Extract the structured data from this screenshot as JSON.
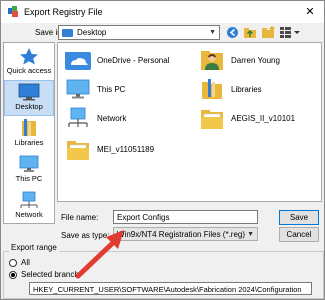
{
  "window": {
    "title": "Export Registry File"
  },
  "save_in": {
    "label": "Save in:",
    "value": "Desktop"
  },
  "places": [
    {
      "label": "Quick access",
      "icon": "quick-access-icon"
    },
    {
      "label": "Desktop",
      "icon": "desktop-icon",
      "selected": true
    },
    {
      "label": "Libraries",
      "icon": "libraries-icon"
    },
    {
      "label": "This PC",
      "icon": "this-pc-icon"
    },
    {
      "label": "Network",
      "icon": "network-icon"
    }
  ],
  "files": [
    {
      "name": "OneDrive - Personal",
      "icon": "onedrive-icon"
    },
    {
      "name": "Darren Young",
      "icon": "user-folder-icon"
    },
    {
      "name": "This PC",
      "icon": "this-pc-icon"
    },
    {
      "name": "Libraries",
      "icon": "libraries-icon"
    },
    {
      "name": "Network",
      "icon": "network-icon"
    },
    {
      "name": "AEGIS_II_v10101",
      "icon": "folder-icon"
    },
    {
      "name": "MEI_v11051189",
      "icon": "folder-icon"
    }
  ],
  "file_name": {
    "label": "File name:",
    "value": "Export Configs"
  },
  "save_as_type": {
    "label": "Save as type:",
    "value": "Win9x/NT4 Registration Files (*.reg)"
  },
  "buttons": {
    "save": "Save",
    "cancel": "Cancel"
  },
  "export_range": {
    "title": "Export range",
    "all_label": "All",
    "selected_label": "Selected branch",
    "selected": "selected_branch",
    "branch_value": "HKEY_CURRENT_USER\\SOFTWARE\\Autodesk\\Fabrication 2024\\Configuration"
  },
  "colors": {
    "annotation_arrow": "#e03c31",
    "accent": "#0078d7",
    "folder": "#e8b73c"
  }
}
